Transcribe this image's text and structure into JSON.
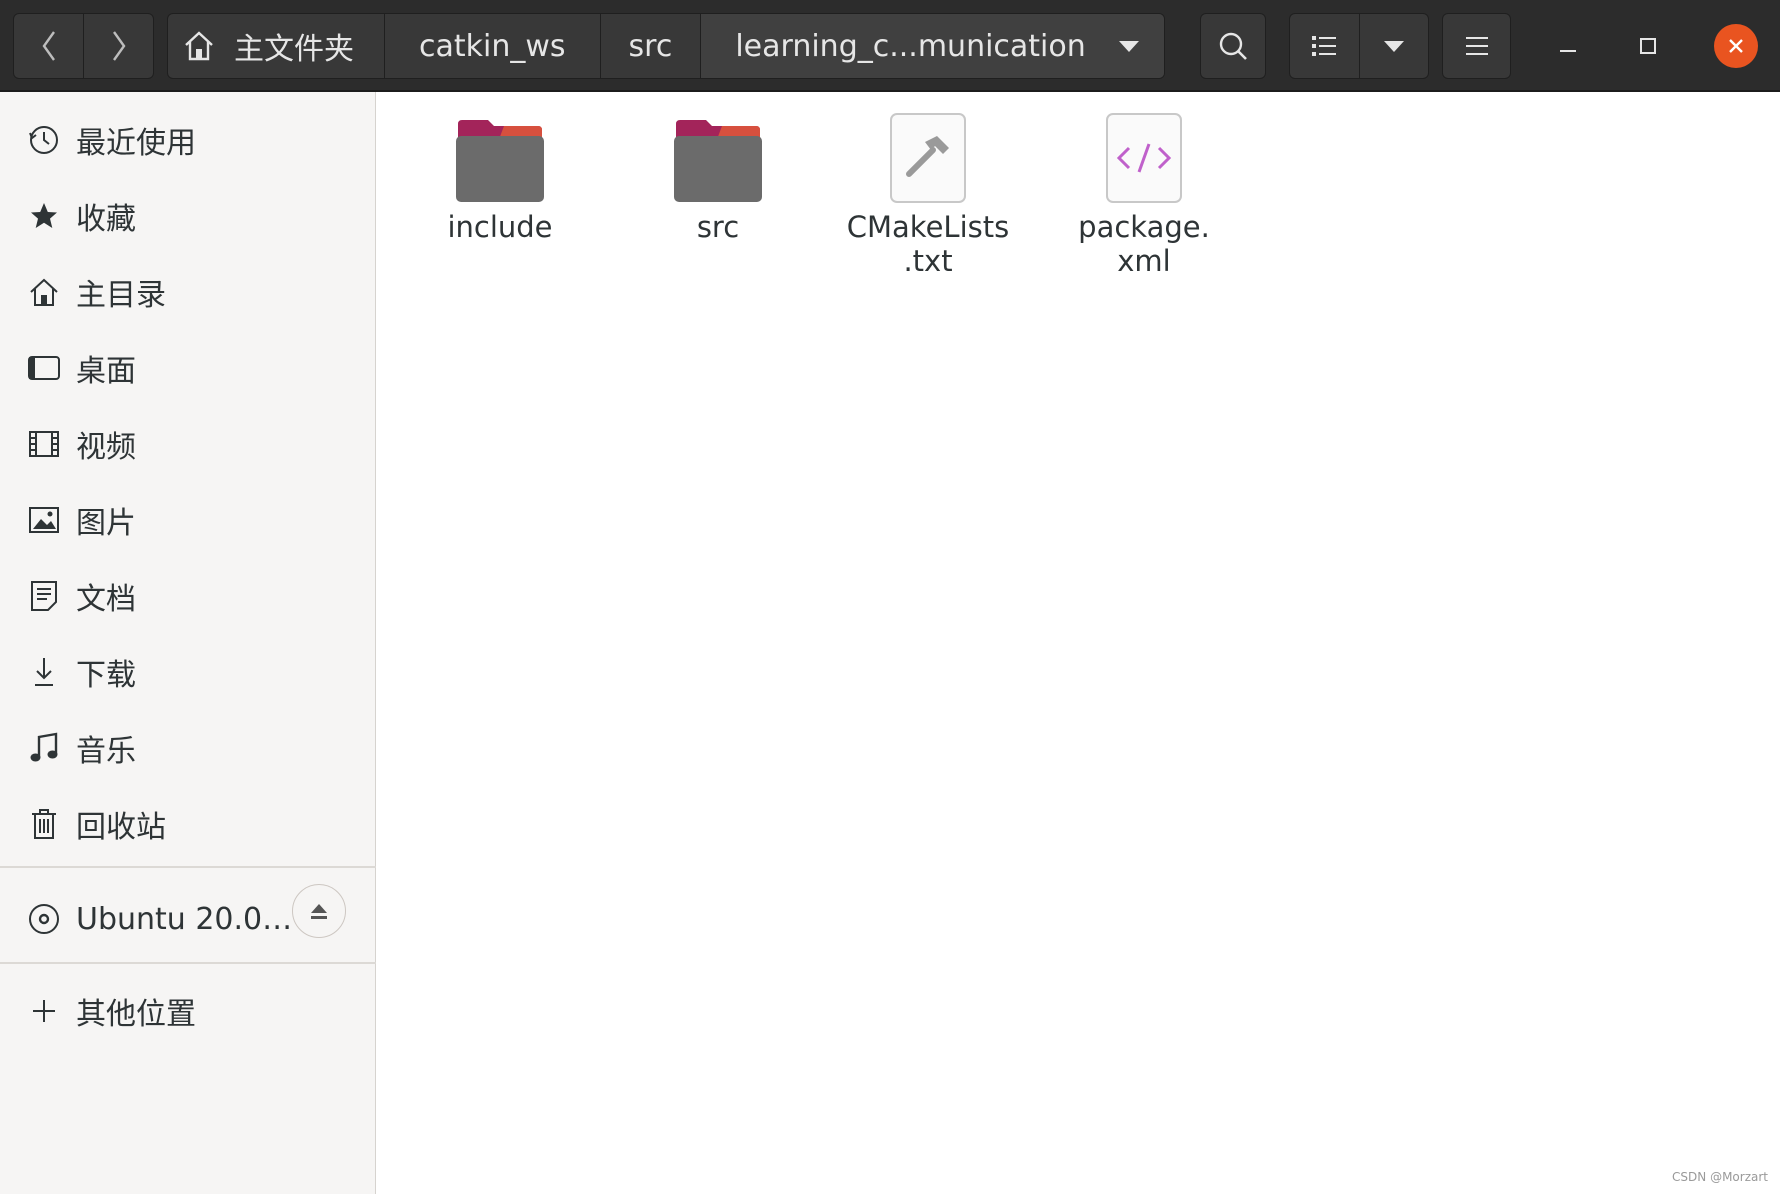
{
  "window": {
    "path": [
      {
        "label": "主文件夹",
        "icon": "home-icon"
      },
      {
        "label": "catkin_ws"
      },
      {
        "label": "src"
      },
      {
        "label": "learning_c...munication"
      }
    ],
    "buttons": {
      "back": "chevron-left-icon",
      "forward": "chevron-right-icon",
      "search": "search-icon",
      "view_list": "list-view-icon",
      "view_options": "triangle-down-icon",
      "menu": "hamburger-icon",
      "minimize": "minimize-icon",
      "maximize": "maximize-icon",
      "close": "close-icon"
    }
  },
  "sidebar": {
    "places": [
      {
        "label": "最近使用",
        "icon": "clock-icon"
      },
      {
        "label": "收藏",
        "icon": "star-icon"
      },
      {
        "label": "主目录",
        "icon": "home-icon"
      },
      {
        "label": "桌面",
        "icon": "desktop-icon"
      },
      {
        "label": "视频",
        "icon": "film-icon"
      },
      {
        "label": "图片",
        "icon": "picture-icon"
      },
      {
        "label": "文档",
        "icon": "document-icon"
      },
      {
        "label": "下载",
        "icon": "download-icon"
      },
      {
        "label": "音乐",
        "icon": "music-icon"
      },
      {
        "label": "回收站",
        "icon": "trash-icon"
      }
    ],
    "devices": [
      {
        "label": "Ubuntu 20.0…",
        "icon": "disc-icon",
        "action_icon": "eject-icon"
      }
    ],
    "other": {
      "label": "其他位置",
      "icon": "plus-icon"
    }
  },
  "files": [
    {
      "name": "include",
      "type": "folder"
    },
    {
      "name": "src",
      "type": "folder"
    },
    {
      "name": "CMakeLists\n.txt",
      "type": "cmake"
    },
    {
      "name": "package.\nxml",
      "type": "xml"
    }
  ],
  "colors": {
    "headerbar": "#2c2c2c",
    "accent": "#e95420",
    "folder_top": "#a3245a",
    "folder_body": "#6b6b6b",
    "xml_glyph": "#c061cb"
  },
  "watermark": "CSDN @Morzart"
}
